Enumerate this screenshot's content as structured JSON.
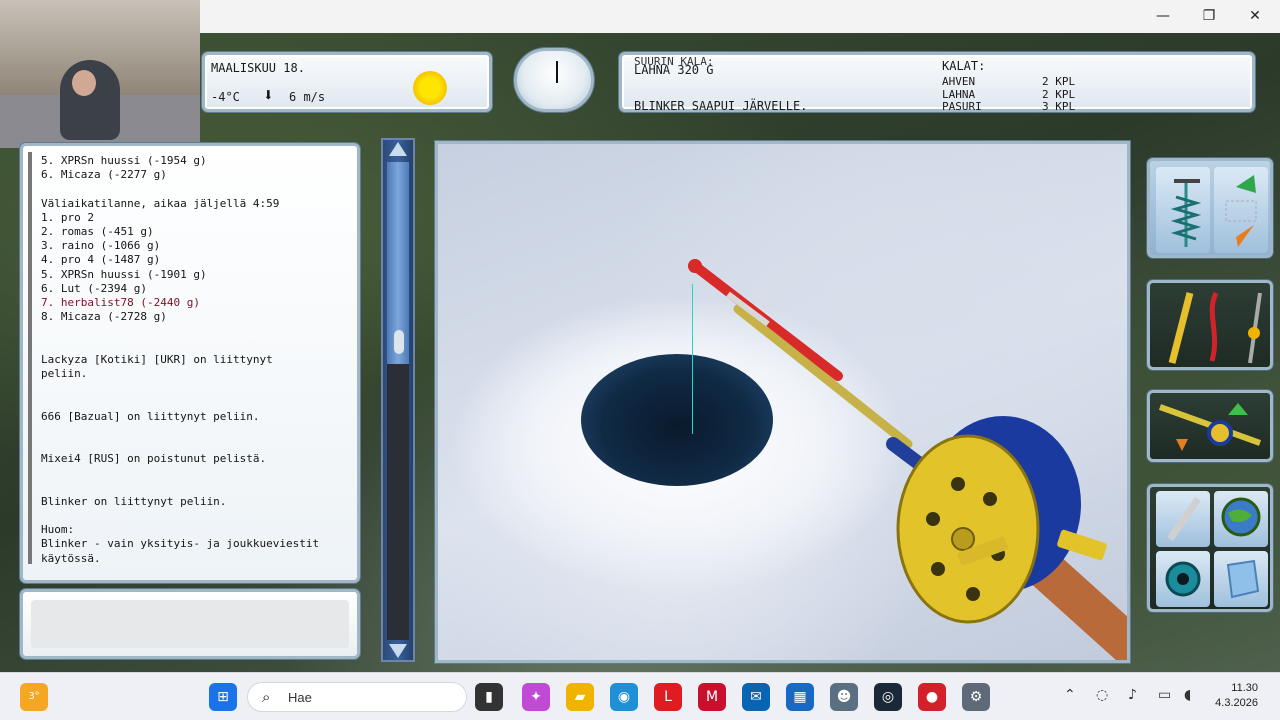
{
  "window": {
    "minimize": "—",
    "restore": "❐",
    "close": "✕"
  },
  "weather": {
    "date": "MAALISKUU 18.",
    "temperature": "-4°C",
    "wind_arrow": "⬇",
    "wind_speed": "6 m/s",
    "sun_icon": "sun-icon"
  },
  "catch_panel": {
    "best_label": "SUURIN KALA:",
    "best_fish": "LAHNA 320 G",
    "event": "BLINKER SAAPUI JÄRVELLE.",
    "kalat_label": "KALAT:",
    "fish": [
      {
        "name": "AHVEN",
        "count": "2 KPL"
      },
      {
        "name": "LAHNA",
        "count": "2 KPL"
      },
      {
        "name": "PASURI",
        "count": "3 KPL"
      }
    ]
  },
  "chat": {
    "lines": [
      {
        "text": "5. XPRSn huussi (-1954 g)",
        "color": "normal"
      },
      {
        "text": "6. Micaza (-2277 g)",
        "color": "normal"
      },
      {
        "text": "",
        "color": "normal"
      },
      {
        "text": "Väliaikatilanne, aikaa jäljellä 4:59",
        "color": "normal"
      },
      {
        "text": "1. pro 2",
        "color": "normal"
      },
      {
        "text": "2. romas (-451 g)",
        "color": "normal"
      },
      {
        "text": "3. raino (-1066 g)",
        "color": "normal"
      },
      {
        "text": "4. pro 4 (-1487 g)",
        "color": "normal"
      },
      {
        "text": "5. XPRSn huussi (-1901 g)",
        "color": "normal"
      },
      {
        "text": "6. Lut (-2394 g)",
        "color": "normal"
      },
      {
        "text": "7. herbalist78 (-2440 g)",
        "color": "red"
      },
      {
        "text": "8. Micaza (-2728 g)",
        "color": "normal"
      },
      {
        "text": "",
        "color": "normal"
      },
      {
        "text": "",
        "color": "normal"
      },
      {
        "text": "Lackyza [Kotiki] [UKR] on liittynyt",
        "color": "normal"
      },
      {
        "text": "peliin.",
        "color": "normal"
      },
      {
        "text": "",
        "color": "normal"
      },
      {
        "text": "",
        "color": "normal"
      },
      {
        "text": "666 [Bazual] on liittynyt peliin.",
        "color": "normal"
      },
      {
        "text": "",
        "color": "normal"
      },
      {
        "text": "",
        "color": "normal"
      },
      {
        "text": "Mixei4 [RUS] on poistunut pelistä.",
        "color": "normal"
      },
      {
        "text": "",
        "color": "normal"
      },
      {
        "text": "",
        "color": "normal"
      },
      {
        "text": "Blinker on liittynyt peliin.",
        "color": "normal"
      },
      {
        "text": "",
        "color": "normal"
      },
      {
        "text": "Huom:",
        "color": "normal"
      },
      {
        "text": "Blinker - vain yksityis- ja joukkueviestit",
        "color": "normal"
      },
      {
        "text": "käytössä.",
        "color": "normal"
      }
    ]
  },
  "depth_gauge": {
    "level": 0.42
  },
  "taskbar": {
    "search_placeholder": "Hae",
    "time": "11.30",
    "date": "4.3.2026",
    "weather_badge": "3°",
    "pinned": [
      {
        "name": "start-button",
        "glyph": "⊞",
        "color": "#1a73e8"
      },
      {
        "name": "file-explorer-icon",
        "glyph": "▮",
        "color": "#333333"
      },
      {
        "name": "copilot-icon",
        "glyph": "✦",
        "color": "#c04ad6"
      },
      {
        "name": "folder-icon",
        "glyph": "▰",
        "color": "#f0b400"
      },
      {
        "name": "edge-icon",
        "glyph": "◉",
        "color": "#1f8fd6"
      },
      {
        "name": "l-app-icon",
        "glyph": "L",
        "color": "#e01b22"
      },
      {
        "name": "mcafee-icon",
        "glyph": "M",
        "color": "#c8102e"
      },
      {
        "name": "outlook-icon",
        "glyph": "✉",
        "color": "#0a64b4"
      },
      {
        "name": "store-icon",
        "glyph": "▦",
        "color": "#1769c4"
      },
      {
        "name": "game-app-icon",
        "glyph": "☻",
        "color": "#5a6f82"
      },
      {
        "name": "steam-icon",
        "glyph": "◎",
        "color": "#1b2838"
      },
      {
        "name": "record-icon",
        "glyph": "●",
        "color": "#d4202a"
      },
      {
        "name": "settings-icon",
        "glyph": "⚙",
        "color": "#5f6a78"
      }
    ]
  }
}
